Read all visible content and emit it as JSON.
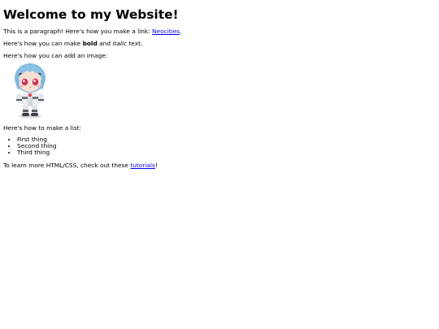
{
  "heading": "Welcome to my Website!",
  "intro": {
    "before": "This is a paragraph! Here's how you make a link: ",
    "link": "Neocities",
    "after": "."
  },
  "format": {
    "before": "Here's how you can make ",
    "bold": "bold",
    "middle": " and ",
    "italic": "italic",
    "after": " text."
  },
  "image_intro": "Here's how you can add an image:",
  "list_intro": "Here's how to make a list:",
  "list_items": [
    "First thing",
    "Second thing",
    "Third thing"
  ],
  "outro": {
    "before": "To learn more HTML/CSS, check out these ",
    "link": "tutorials",
    "after": "!"
  },
  "colors": {
    "link": "#0000ee",
    "text": "#000000",
    "background": "#ffffff"
  },
  "image_icon": "figure-plush-image"
}
